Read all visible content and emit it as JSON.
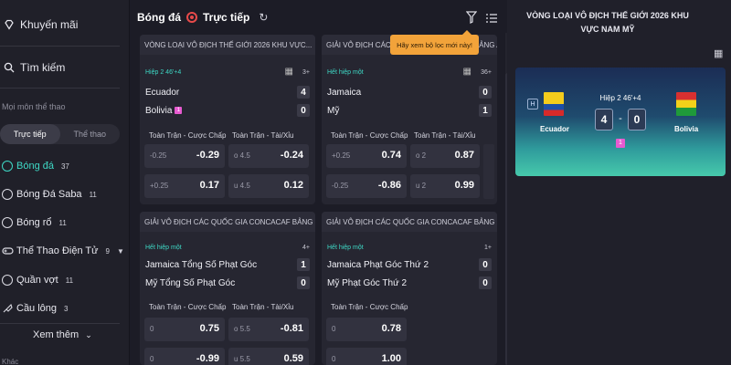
{
  "sidebar": {
    "promo": "Khuyến mãi",
    "search": "Tìm kiếm",
    "section": "Mọi môn thể thao",
    "toggle": {
      "live": "Trực tiếp",
      "sports": "Thể thao"
    },
    "sports": [
      {
        "label": "Bóng đá",
        "count": "37",
        "icon": "soccer-ball-icon"
      },
      {
        "label": "Bóng Đá Saba",
        "count": "11",
        "icon": "soccer-ball-icon"
      },
      {
        "label": "Bóng rổ",
        "count": "11",
        "icon": "basketball-icon"
      },
      {
        "label": "Thể Thao Điện Tử",
        "count": "9",
        "icon": "gamepad-icon"
      },
      {
        "label": "Quần vợt",
        "count": "11",
        "icon": "tennis-ball-icon"
      },
      {
        "label": "Cầu lông",
        "count": "3",
        "icon": "shuttlecock-icon"
      }
    ],
    "see_more": "Xem thêm",
    "next_section": "Khác"
  },
  "header": {
    "sport": "Bóng đá",
    "live": "Trực tiếp"
  },
  "tooltip": "Hãy xem bộ lọc mới này!",
  "cards": [
    {
      "league": "VÒNG LOẠI VÔ ĐỊCH THẾ GIỚI 2026 KHU VỰC...",
      "status": "Hiệp 2 46'+4",
      "count": "3+",
      "home": "Ecuador",
      "away": "Bolivia",
      "home_score": "4",
      "away_score": "0",
      "away_badge": "1",
      "market1": "Toàn Trận - Cược Chấp",
      "market2": "Toàn Trận - Tài/Xỉu",
      "odds": [
        [
          "-0.25",
          "-0.29"
        ],
        [
          "o 4.5",
          "-0.24"
        ],
        [
          "+0.25",
          "0.17"
        ],
        [
          "u 4.5",
          "0.12"
        ]
      ]
    },
    {
      "league": "GIẢI VÔ ĐỊCH CÁC QUỐC GIA CONCACAF BẢNG A",
      "status": "Hết hiệp một",
      "count": "36+",
      "home": "Jamaica",
      "away": "Mỹ",
      "home_score": "0",
      "away_score": "1",
      "market1": "Toàn Trận - Cược Chấp",
      "market2": "Toàn Trận - Tài/Xỉu",
      "odds": [
        [
          "+0.25",
          "0.74"
        ],
        [
          "o 2",
          "0.87"
        ],
        [
          "-0.25",
          "-0.86"
        ],
        [
          "u 2",
          "0.99"
        ]
      ]
    },
    {
      "league": "GIẢI VÔ ĐỊCH CÁC QUỐC GIA CONCACAF BẢNG ...",
      "status": "Hết hiệp một",
      "count": "4+",
      "home": "Jamaica Tổng Số Phạt Góc",
      "away": "Mỹ Tổng Số Phạt Góc",
      "home_score": "1",
      "away_score": "0",
      "market1": "Toàn Trận - Cược Chấp",
      "market2": "Toàn Trận - Tài/Xỉu",
      "odds": [
        [
          "0",
          "0.75"
        ],
        [
          "o 5.5",
          "-0.81"
        ],
        [
          "0",
          "-0.99"
        ],
        [
          "u 5.5",
          "0.59"
        ]
      ]
    },
    {
      "league": "GIẢI VÔ ĐỊCH CÁC QUỐC GIA CONCACAF BẢNG ...",
      "status": "Hết hiệp một",
      "count": "1+",
      "home": "Jamaica Phạt Góc Thứ 2",
      "away": "Mỹ Phạt Góc Thứ 2",
      "home_score": "0",
      "away_score": "0",
      "market1": "Toàn Trận - Cược Chấp",
      "odds": [
        [
          "0",
          "0.78"
        ],
        [
          "0",
          "1.00"
        ]
      ]
    }
  ],
  "featured": {
    "title": "VÒNG LOẠI VÔ ĐỊCH THẾ GIỚI 2026 KHU VỰC NAM MỸ",
    "status": "Hiệp 2 46'+4",
    "home": "Ecuador",
    "away": "Bolivia",
    "home_score": "4",
    "away_score": "0",
    "separator": "-",
    "badge": "1",
    "h_label": "H"
  }
}
